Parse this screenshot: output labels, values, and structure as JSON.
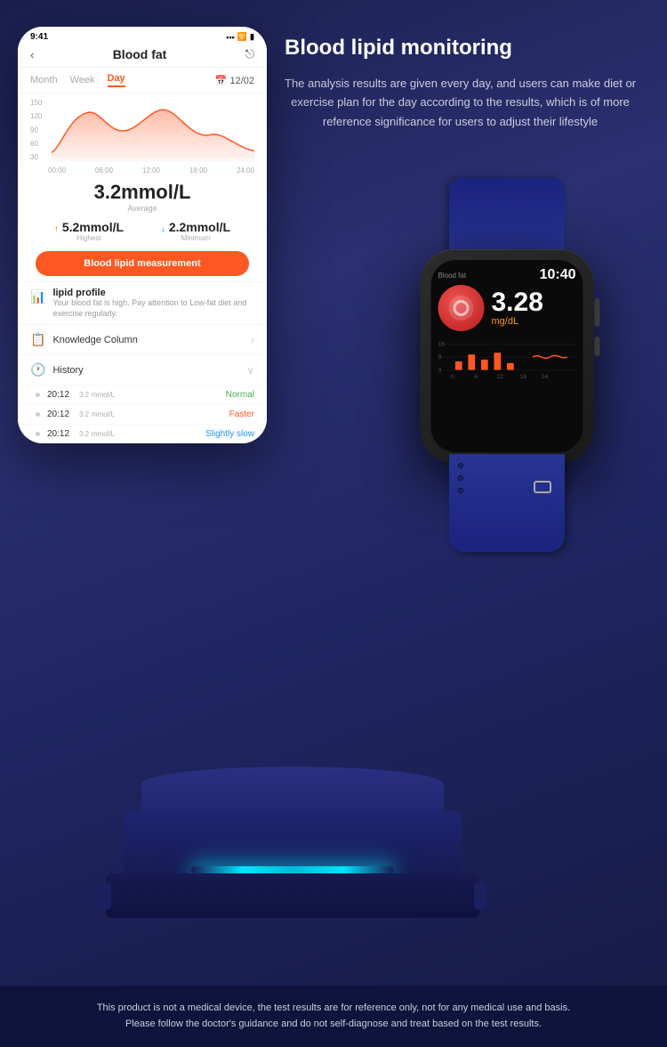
{
  "phone": {
    "status_time": "9:41",
    "header_title": "Blood fat",
    "tabs": [
      "Month",
      "Week",
      "Day"
    ],
    "active_tab": "Day",
    "date": "12/02",
    "chart": {
      "y_labels": [
        "150",
        "120",
        "90",
        "60",
        "30"
      ],
      "x_labels": [
        "00:00",
        "06:00",
        "12:00",
        "18:00",
        "24:00"
      ]
    },
    "main_value": "3.2mmol/L",
    "main_label": "Average",
    "highest_value": "5.2mmol/L",
    "highest_label": "Highest",
    "minimum_value": "2.2mmol/L",
    "minimum_label": "Minimum",
    "measure_btn": "Blood lipid measurement",
    "lipid_profile_title": "lipid profile",
    "lipid_profile_desc": "Your blood fat is high. Pay attention to Low-fat diet and exercise regularly.",
    "knowledge_label": "Knowledge Column",
    "history_label": "History",
    "history_items": [
      {
        "time": "20:12",
        "value": "3.2",
        "unit": "mmol/L",
        "status": "Normal",
        "status_class": "status-normal"
      },
      {
        "time": "20:12",
        "value": "3.2",
        "unit": "mmol/L",
        "status": "Faster",
        "status_class": "status-faster"
      },
      {
        "time": "20:12",
        "value": "3.2",
        "unit": "mmol/L",
        "status": "Slightly slow",
        "status_class": "status-slow"
      }
    ]
  },
  "feature": {
    "title": "Blood lipid monitoring",
    "description": "The analysis results are given every day, and users can make diet or exercise plan for the day according to the results, which is of more reference significance for users to adjust their lifestyle"
  },
  "watch": {
    "label": "Blood fat",
    "time": "10:40",
    "value": "3.28",
    "unit": "mg/dL"
  },
  "disclaimer": {
    "line1": "This product is not a medical device, the test results are for reference only, not for any medical use and basis.",
    "line2": "Please follow the doctor's guidance and do not self-diagnose and treat based on the test results."
  }
}
